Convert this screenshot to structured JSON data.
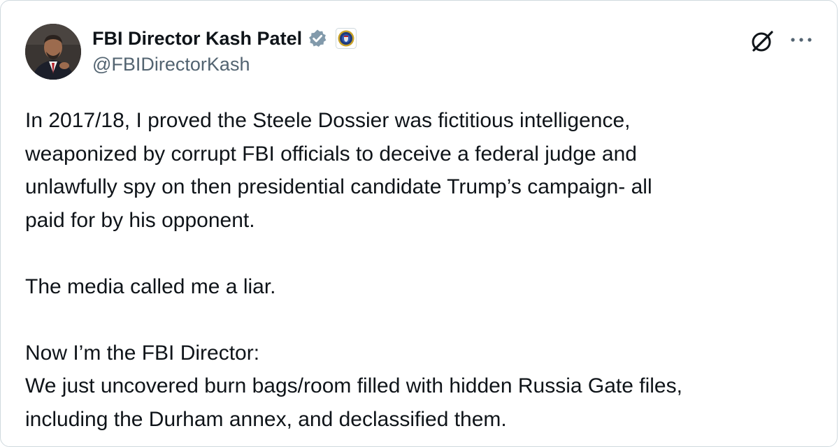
{
  "author": {
    "display_name": "FBI Director Kash Patel",
    "handle": "@FBIDirectorKash",
    "verified_icon": "verified-badge-icon",
    "affiliation_icon": "fbi-seal-icon",
    "avatar": "profile-photo"
  },
  "actions": {
    "grok_icon": "grok-icon",
    "more_icon": "more-options-icon"
  },
  "tweet": {
    "paragraph_1": "In 2017/18, I proved the Steele Dossier was fictitious intelligence,\nweaponized by corrupt FBI officials to deceive a federal judge and\nunlawfully spy on then presidential candidate Trump’s campaign- all\npaid for by his opponent.",
    "paragraph_2": "The media called me a liar.",
    "paragraph_3": "Now I’m the FBI Director:\nWe just uncovered burn bags/room filled with hidden Russia Gate files,\nincluding the Durham annex, and declassified them."
  },
  "colors": {
    "text_primary": "#0f1419",
    "text_secondary": "#536471",
    "verified_blue": "#829aab",
    "border": "#cfd9de"
  }
}
